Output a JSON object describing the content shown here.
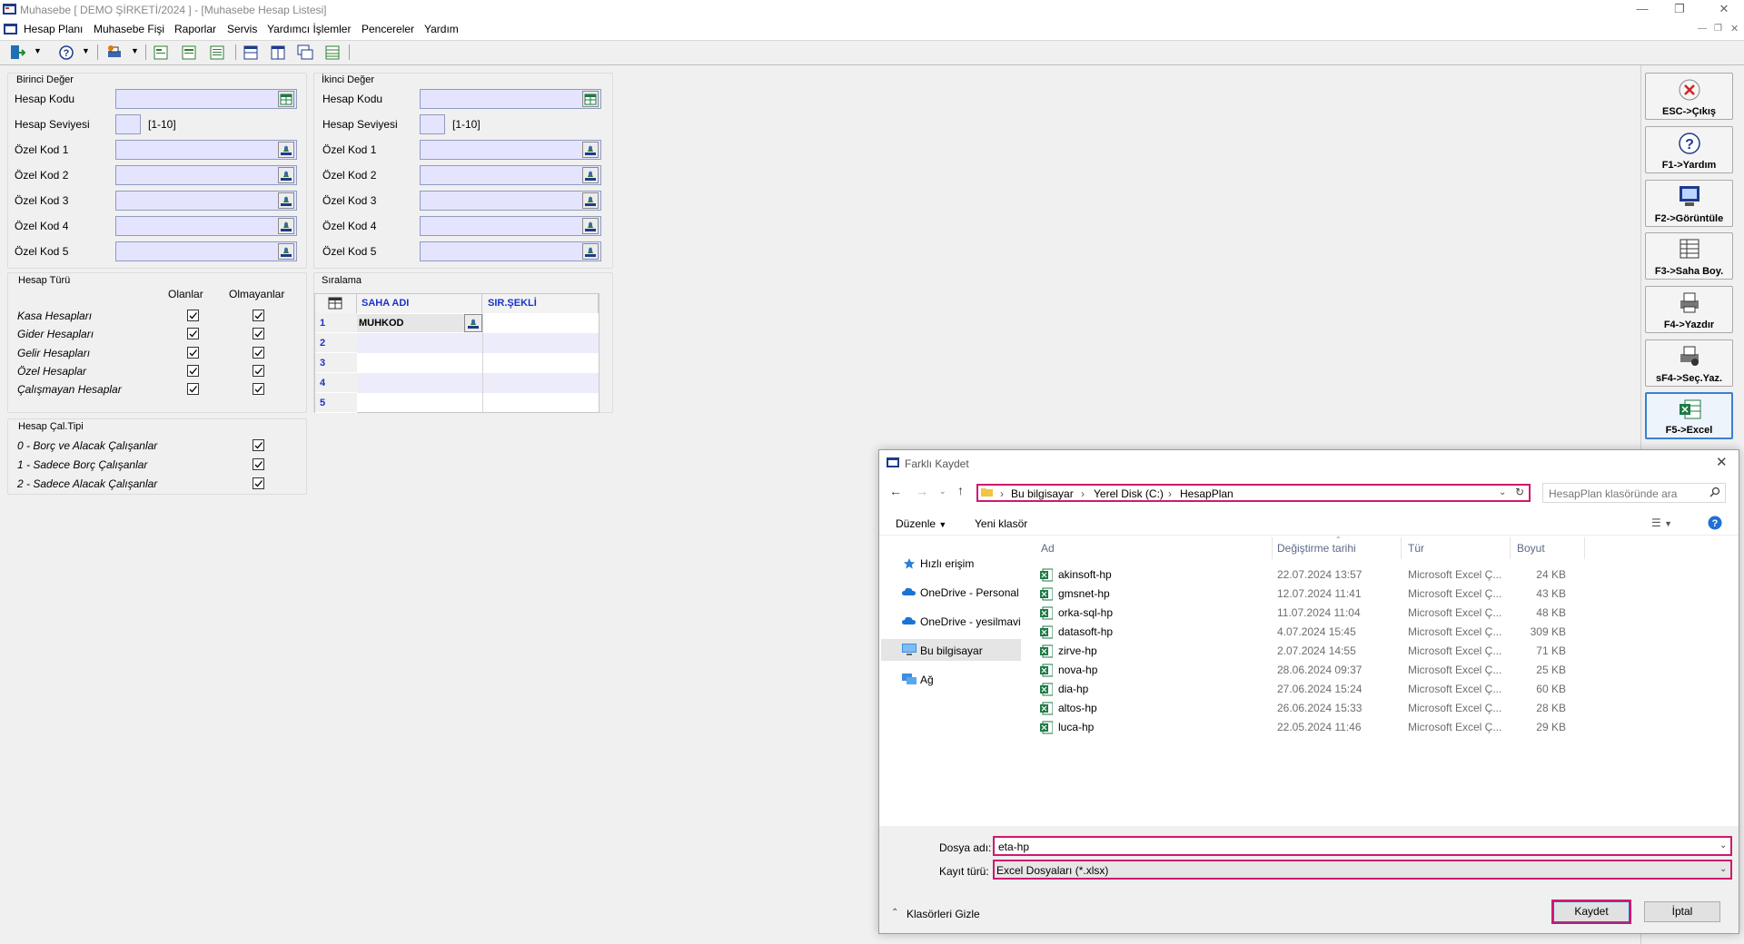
{
  "window": {
    "title": "Muhasebe [ DEMO ŞİRKETİ/2024 ]  - [Muhasebe Hesap Listesi]"
  },
  "menu": [
    "Hesap Planı",
    "Muhasebe Fişi",
    "Raporlar",
    "Servis",
    "Yardımcı İşlemler",
    "Pencereler",
    "Yardım"
  ],
  "birinci": {
    "title": "Birinci Değer",
    "hesap_kodu": "Hesap Kodu",
    "hesap_seviyesi": "Hesap Seviyesi",
    "range": "[1-10]",
    "ozel": [
      "Özel Kod 1",
      "Özel Kod 2",
      "Özel Kod 3",
      "Özel Kod 4",
      "Özel Kod 5"
    ]
  },
  "ikinci": {
    "title": "İkinci Değer",
    "hesap_kodu": "Hesap Kodu",
    "hesap_seviyesi": "Hesap Seviyesi",
    "range": "[1-10]",
    "ozel": [
      "Özel Kod 1",
      "Özel Kod 2",
      "Özel Kod 3",
      "Özel Kod 4",
      "Özel Kod 5"
    ]
  },
  "hesap_turu": {
    "title": "Hesap Türü",
    "col_olanlar": "Olanlar",
    "col_olmayanlar": "Olmayanlar",
    "rows": [
      "Kasa Hesapları",
      "Gider Hesapları",
      "Gelir Hesapları",
      "Özel Hesaplar",
      "Çalışmayan Hesaplar"
    ]
  },
  "hesap_cal": {
    "title": "Hesap Çal.Tipi",
    "rows": [
      "0 - Borç ve Alacak Çalışanlar",
      "1 - Sadece Borç Çalışanlar",
      "2 - Sadece Alacak Çalışanlar"
    ]
  },
  "siralama": {
    "title": "Sıralama",
    "col_saha": "SAHA ADI",
    "col_sir": "SIR.ŞEKLİ",
    "rows": [
      "1",
      "2",
      "3",
      "4",
      "5"
    ],
    "first_value": "MUHKOD"
  },
  "fkeys": [
    "ESC->Çıkış",
    "F1->Yardım",
    "F2->Görüntüle",
    "F3->Saha Boy.",
    "F4->Yazdır",
    "sF4->Seç.Yaz.",
    "F5->Excel"
  ],
  "dialog": {
    "title": "Farklı Kaydet",
    "path": [
      "Bu bilgisayar",
      "Yerel Disk (C:)",
      "HesapPlan"
    ],
    "search_placeholder": "HesapPlan klasöründe ara",
    "organize": "Düzenle",
    "new_folder": "Yeni klasör",
    "nav": [
      "Hızlı erişim",
      "OneDrive - Personal",
      "OneDrive - yesilmaviy",
      "Bu bilgisayar",
      "Ağ"
    ],
    "columns": [
      "Ad",
      "Değiştirme tarihi",
      "Tür",
      "Boyut"
    ],
    "files": [
      {
        "name": "akinsoft-hp",
        "date": "22.07.2024 13:57",
        "type": "Microsoft Excel Ç...",
        "size": "24 KB"
      },
      {
        "name": "gmsnet-hp",
        "date": "12.07.2024 11:41",
        "type": "Microsoft Excel Ç...",
        "size": "43 KB"
      },
      {
        "name": "orka-sql-hp",
        "date": "11.07.2024 11:04",
        "type": "Microsoft Excel Ç...",
        "size": "48 KB"
      },
      {
        "name": "datasoft-hp",
        "date": "4.07.2024 15:45",
        "type": "Microsoft Excel Ç...",
        "size": "309 KB"
      },
      {
        "name": "zirve-hp",
        "date": "2.07.2024 14:55",
        "type": "Microsoft Excel Ç...",
        "size": "71 KB"
      },
      {
        "name": "nova-hp",
        "date": "28.06.2024 09:37",
        "type": "Microsoft Excel Ç...",
        "size": "25 KB"
      },
      {
        "name": "dia-hp",
        "date": "27.06.2024 15:24",
        "type": "Microsoft Excel Ç...",
        "size": "60 KB"
      },
      {
        "name": "altos-hp",
        "date": "26.06.2024 15:33",
        "type": "Microsoft Excel Ç...",
        "size": "28 KB"
      },
      {
        "name": "luca-hp",
        "date": "22.05.2024 11:46",
        "type": "Microsoft Excel Ç...",
        "size": "29 KB"
      }
    ],
    "filename_label": "Dosya adı:",
    "filename_value": "eta-hp",
    "filetype_label": "Kayıt türü:",
    "filetype_value": "Excel Dosyaları (*.xlsx)",
    "hide_folders": "Klasörleri Gizle",
    "save": "Kaydet",
    "cancel": "İptal"
  },
  "colors": {
    "field_bg": "#e4e4ff",
    "highlight": "#d0186e",
    "grid_header": "#1c33c7",
    "excel_green": "#1d7a45"
  }
}
